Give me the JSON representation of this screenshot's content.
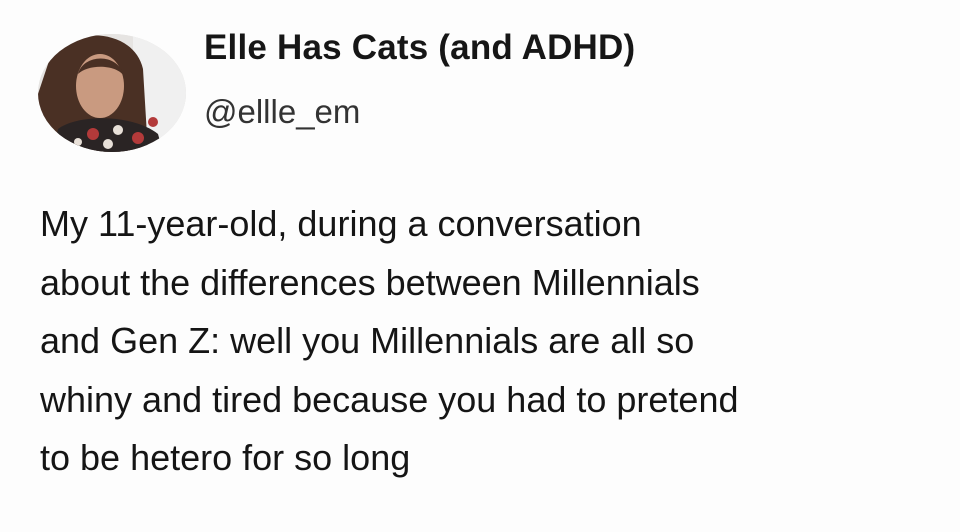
{
  "tweet": {
    "display_name": "Elle Has Cats (and ADHD)",
    "handle": "@ellle_em",
    "text_lines": [
      "My 11-year-old, during a conversation",
      "about the differences between Millennials",
      "and Gen Z: well you Millennials are all so",
      "whiny and tired because you had to pretend",
      "to be hetero for so long"
    ]
  }
}
